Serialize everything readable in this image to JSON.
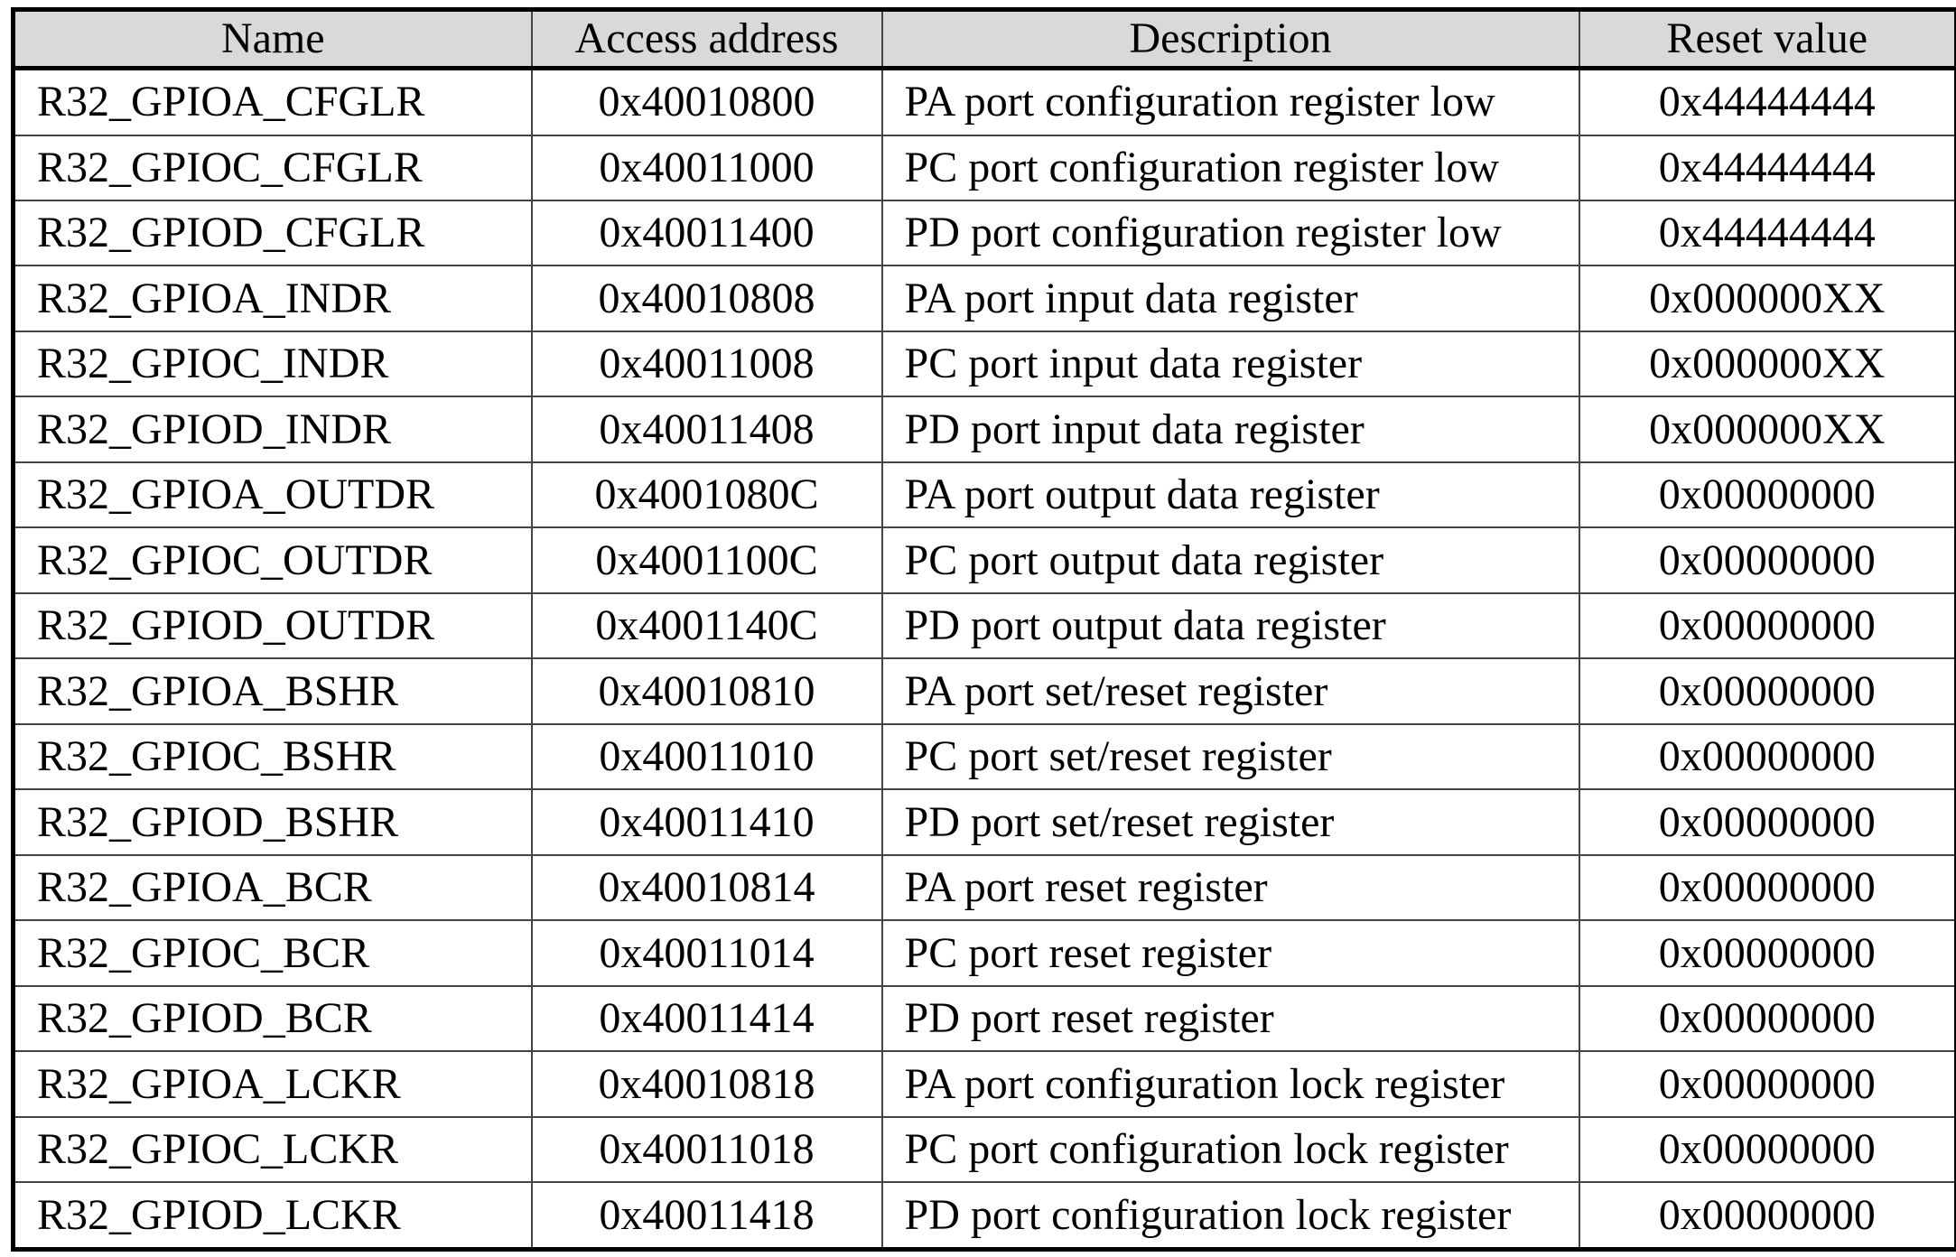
{
  "table": {
    "headers": {
      "name": "Name",
      "address": "Access address",
      "description": "Description",
      "reset": "Reset value"
    },
    "rows": [
      {
        "name": "R32_GPIOA_CFGLR",
        "address": "0x40010800",
        "description": "PA port configuration register low",
        "reset": "0x44444444"
      },
      {
        "name": "R32_GPIOC_CFGLR",
        "address": "0x40011000",
        "description": "PC port configuration register low",
        "reset": "0x44444444"
      },
      {
        "name": "R32_GPIOD_CFGLR",
        "address": "0x40011400",
        "description": "PD port configuration register low",
        "reset": "0x44444444"
      },
      {
        "name": "R32_GPIOA_INDR",
        "address": "0x40010808",
        "description": "PA port input data register",
        "reset": "0x000000XX"
      },
      {
        "name": "R32_GPIOC_INDR",
        "address": "0x40011008",
        "description": "PC port input data register",
        "reset": "0x000000XX"
      },
      {
        "name": "R32_GPIOD_INDR",
        "address": "0x40011408",
        "description": "PD port input data register",
        "reset": "0x000000XX"
      },
      {
        "name": "R32_GPIOA_OUTDR",
        "address": "0x4001080C",
        "description": "PA port output data register",
        "reset": "0x00000000"
      },
      {
        "name": "R32_GPIOC_OUTDR",
        "address": "0x4001100C",
        "description": "PC port output data register",
        "reset": "0x00000000"
      },
      {
        "name": "R32_GPIOD_OUTDR",
        "address": "0x4001140C",
        "description": "PD port output data register",
        "reset": "0x00000000"
      },
      {
        "name": "R32_GPIOA_BSHR",
        "address": "0x40010810",
        "description": "PA port set/reset register",
        "reset": "0x00000000"
      },
      {
        "name": "R32_GPIOC_BSHR",
        "address": "0x40011010",
        "description": "PC port set/reset register",
        "reset": "0x00000000"
      },
      {
        "name": "R32_GPIOD_BSHR",
        "address": "0x40011410",
        "description": "PD port set/reset register",
        "reset": "0x00000000"
      },
      {
        "name": "R32_GPIOA_BCR",
        "address": "0x40010814",
        "description": "PA port reset register",
        "reset": "0x00000000"
      },
      {
        "name": "R32_GPIOC_BCR",
        "address": "0x40011014",
        "description": "PC port reset register",
        "reset": "0x00000000"
      },
      {
        "name": "R32_GPIOD_BCR",
        "address": "0x40011414",
        "description": "PD port reset register",
        "reset": "0x00000000"
      },
      {
        "name": "R32_GPIOA_LCKR",
        "address": "0x40010818",
        "description": "PA port configuration lock register",
        "reset": "0x00000000"
      },
      {
        "name": "R32_GPIOC_LCKR",
        "address": "0x40011018",
        "description": "PC port configuration lock register",
        "reset": "0x00000000"
      },
      {
        "name": "R32_GPIOD_LCKR",
        "address": "0x40011418",
        "description": "PD port configuration lock register",
        "reset": "0x00000000"
      }
    ]
  }
}
